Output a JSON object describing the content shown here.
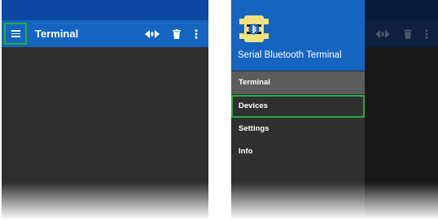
{
  "colors": {
    "status_bar": "#0d47a1",
    "toolbar": "#1565c0",
    "content_bg": "#2f2f2f",
    "drawer_bg": "#303030",
    "drawer_selected": "#5c5c5c",
    "dimmed_status": "#0a1a3d",
    "dimmed_toolbar": "#0f1f3e",
    "dimmed_content": "#181818",
    "highlight": "#27ad3e",
    "logo_yellow": "#f2e27e"
  },
  "left": {
    "toolbar": {
      "title": "Terminal",
      "menu_icon": "hamburger-icon",
      "connect_icon": "connect-icon",
      "delete_icon": "trash-icon",
      "more_icon": "more-vert-icon"
    }
  },
  "right": {
    "drawer": {
      "app_name": "Serial Bluetooth Terminal",
      "logo_icon": "serial-bluetooth-logo-icon",
      "items": [
        {
          "label": "Terminal",
          "selected": true
        },
        {
          "label": "Devices",
          "highlighted": true
        },
        {
          "label": "Settings"
        },
        {
          "label": "Info"
        }
      ]
    },
    "toolbar": {
      "connect_icon": "connect-icon",
      "delete_icon": "trash-icon",
      "more_icon": "more-vert-icon"
    }
  }
}
